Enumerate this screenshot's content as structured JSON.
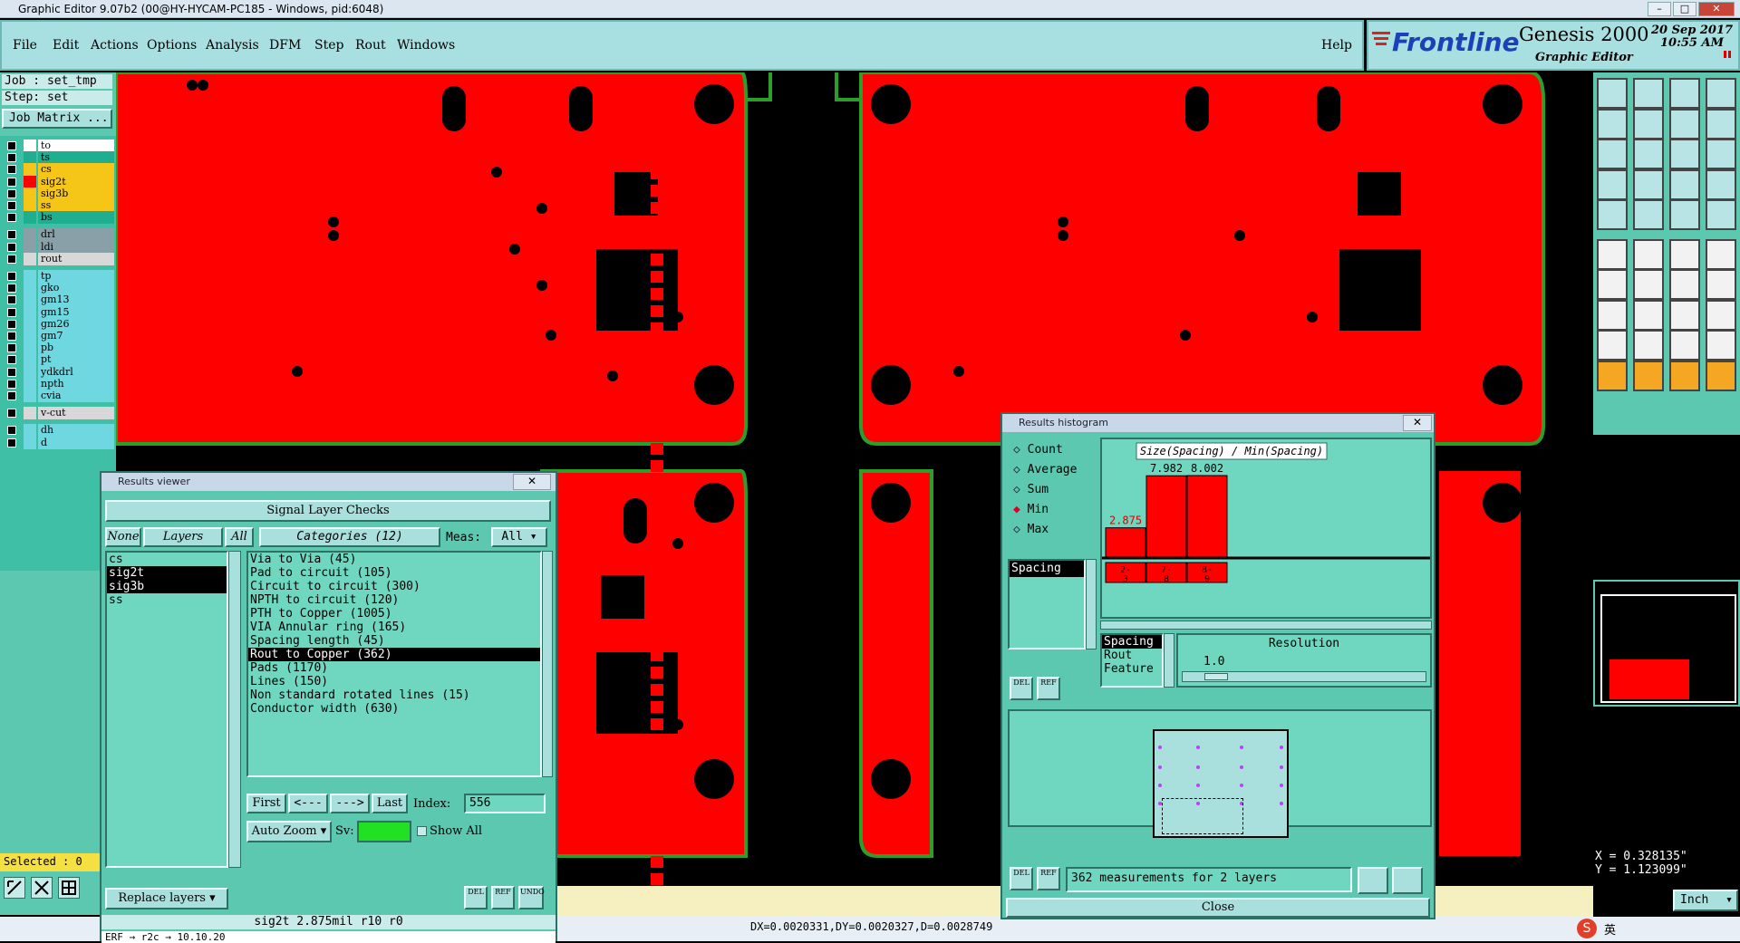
{
  "app": {
    "title": "Graphic Editor 9.07b2 (00@HY-HYCAM-PC185 - Windows, pid:6048)",
    "min": "–",
    "max": "□",
    "close": "✕"
  },
  "menu": [
    "File",
    "Edit",
    "Actions",
    "Options",
    "Analysis",
    "DFM",
    "Step",
    "Rout",
    "Windows"
  ],
  "help": "Help",
  "brand": {
    "logo": "Frontline",
    "product": "Genesis 2000",
    "subtitle": "Graphic Editor",
    "date": "20 Sep 2017",
    "time": "10:55 AM"
  },
  "job": {
    "job_label": "Job : set_tmp",
    "step_label": "Step: set",
    "matrix_button": "Job Matrix ..."
  },
  "layers": [
    {
      "name": "to",
      "color": "#ffffff",
      "col": "#ffffff"
    },
    {
      "name": "ts",
      "color": "#1fae8f",
      "col": "#1fae8f"
    },
    {
      "name": "cs",
      "color": "#f5c518",
      "col": "#f5c518"
    },
    {
      "name": "sig2t",
      "color": "#f5c518",
      "col": "#ff0000"
    },
    {
      "name": "sig3b",
      "color": "#f5c518",
      "col": "#f5c518"
    },
    {
      "name": "ss",
      "color": "#f5c518",
      "col": "#f5c518"
    },
    {
      "name": "bs",
      "color": "#1fae8f",
      "col": "#1fae8f"
    },
    {
      "name": "drl",
      "color": "#8aa0a8",
      "col": "#8aa0a8"
    },
    {
      "name": "ldi",
      "color": "#8aa0a8",
      "col": "#8aa0a8"
    },
    {
      "name": "rout",
      "color": "#d8d8d8",
      "col": "#d8d8d8"
    },
    {
      "name": "tp",
      "color": "#6fd7e0",
      "col": "#6fd7e0"
    },
    {
      "name": "gko",
      "color": "#6fd7e0",
      "col": "#6fd7e0"
    },
    {
      "name": "gm13",
      "color": "#6fd7e0",
      "col": "#6fd7e0"
    },
    {
      "name": "gm15",
      "color": "#6fd7e0",
      "col": "#6fd7e0"
    },
    {
      "name": "gm26",
      "color": "#6fd7e0",
      "col": "#6fd7e0"
    },
    {
      "name": "gm7",
      "color": "#6fd7e0",
      "col": "#6fd7e0"
    },
    {
      "name": "pb",
      "color": "#6fd7e0",
      "col": "#6fd7e0"
    },
    {
      "name": "pt",
      "color": "#6fd7e0",
      "col": "#6fd7e0"
    },
    {
      "name": "ydkdrl",
      "color": "#6fd7e0",
      "col": "#6fd7e0"
    },
    {
      "name": "npth",
      "color": "#6fd7e0",
      "col": "#6fd7e0"
    },
    {
      "name": "cvia",
      "color": "#6fd7e0",
      "col": "#6fd7e0"
    },
    {
      "name": "v-cut",
      "color": "#d8d8d8",
      "col": "#d8d8d8"
    },
    {
      "name": "dh",
      "color": "#6fd7e0",
      "col": "#6fd7e0"
    },
    {
      "name": "d",
      "color": "#6fd7e0",
      "col": "#6fd7e0"
    }
  ],
  "selected": "Selected : 0",
  "results_viewer": {
    "title": "Results viewer",
    "header": "Signal Layer Checks",
    "none": "None",
    "layers_btn": "Layers",
    "all": "All",
    "categories": "Categories (12)",
    "meas_label": "Meas:",
    "meas_value": "All",
    "layer_list": [
      "cs",
      "sig2t",
      "sig3b",
      "ss"
    ],
    "category_list": [
      "Via to Via (45)",
      "Pad to circuit (105)",
      "Circuit to circuit (300)",
      "NPTH to circuit (120)",
      "PTH to Copper (1005)",
      "VIA Annular ring (165)",
      "Spacing length (45)",
      "Rout to Copper (362)",
      "Pads (1170)",
      "Lines (150)",
      "Non standard rotated lines (15)",
      "Conductor width (630)"
    ],
    "first": "First",
    "prev": "<---",
    "next": "--->",
    "last": "Last",
    "index_label": "Index:",
    "index_value": "556",
    "auto_zoom": "Auto Zoom",
    "sv": "Sv:",
    "show_all": "Show All",
    "replace_layers": "Replace layers",
    "del": "DEL",
    "ref": "REF",
    "undo": "UNDO",
    "status": "sig2t 2.875mil r10 r0",
    "footer": "ERF → r2c → 10.10.20"
  },
  "histogram": {
    "title": "Results histogram",
    "options": [
      "Count",
      "Average",
      "Sum",
      "Min",
      "Max"
    ],
    "selected_option": "Min",
    "measure_list": [
      "Spacing"
    ],
    "chart_title": "Size(Spacing) / Min(Spacing)",
    "type_list": [
      "Spacing",
      "Rout",
      "Feature"
    ],
    "resolution_label": "Resolution",
    "resolution_value": "1.0",
    "summary": "362 measurements for 2 layers",
    "close": "Close",
    "del": "DEL",
    "ref": "REF",
    "chart_data": {
      "type": "bar",
      "title": "Size(Spacing) / Min(Spacing)",
      "categories": [
        "2-3",
        "7-8",
        "8-9"
      ],
      "values": [
        2.875,
        7.982,
        8.002
      ]
    }
  },
  "coords": {
    "x": "X = 0.328135\"",
    "y": "Y = 1.123099\"",
    "unit": "Inch",
    "delta": "DX=0.0020331,DY=0.0020327,D=0.0028749"
  },
  "taskbar": {
    "ime": "英"
  }
}
